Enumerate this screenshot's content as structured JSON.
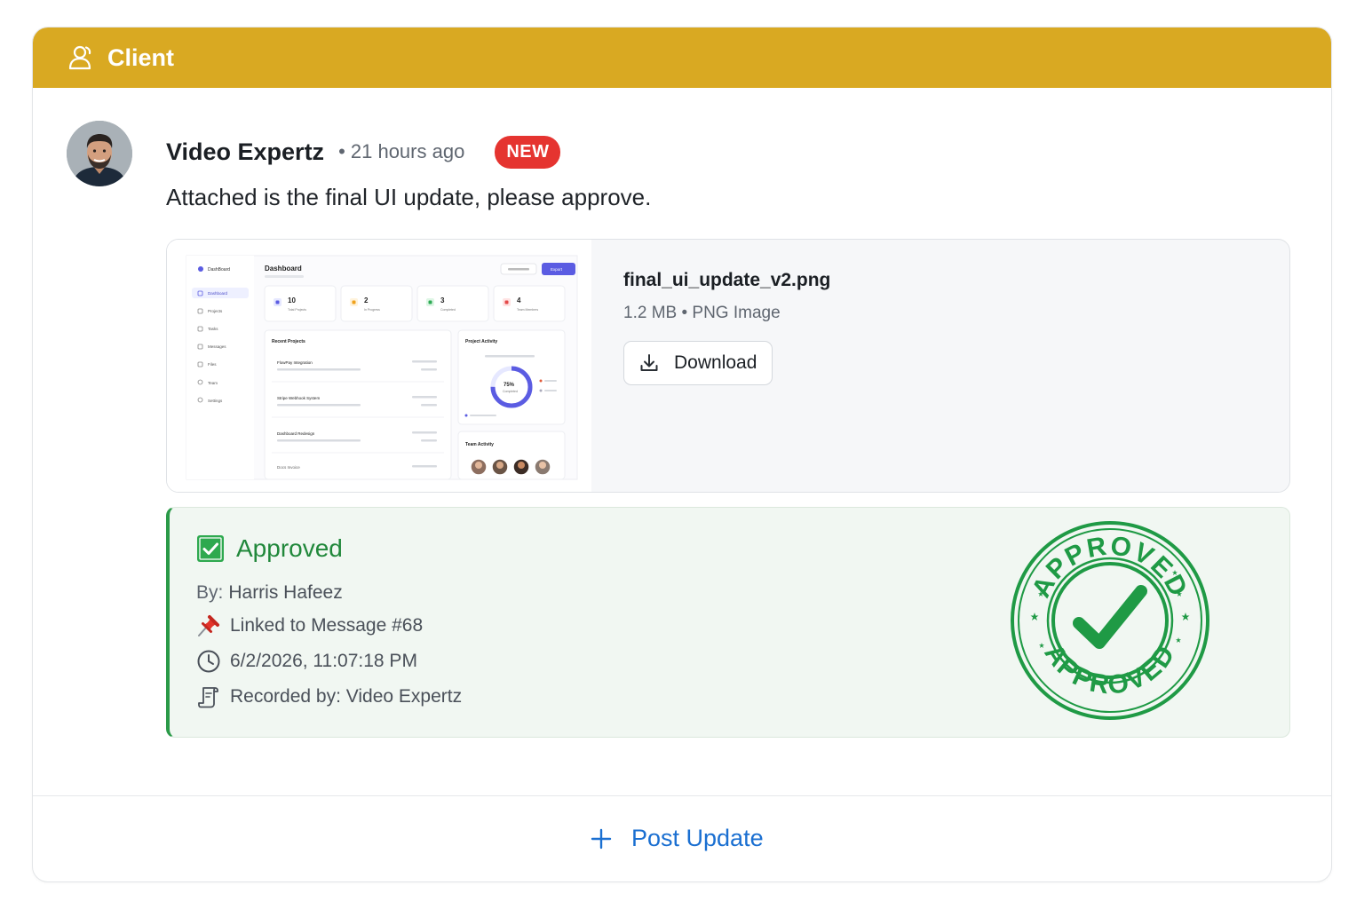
{
  "header": {
    "title": "Client",
    "icon": "user-icon",
    "color": "#d9a922"
  },
  "post": {
    "author": "Video Expertz",
    "time": "• 21 hours ago",
    "badge": "NEW",
    "message": "Attached is the final UI update, please approve.",
    "avatar_icon": "avatar-photo"
  },
  "attachment": {
    "file_name": "final_ui_update_v2.png",
    "file_meta": "1.2 MB • PNG Image",
    "download_label": "Download",
    "preview": {
      "brand": "DashBoard",
      "title": "Dashboard",
      "top_button": "Export",
      "nav": [
        "Dashboard",
        "Projects",
        "Tasks",
        "Messages",
        "Files",
        "Team",
        "Settings"
      ],
      "stats": [
        {
          "value": "10",
          "label": "Total Projects"
        },
        {
          "value": "2",
          "label": "In Progress"
        },
        {
          "value": "3",
          "label": "Completed"
        },
        {
          "value": "4",
          "label": "Team Members"
        }
      ],
      "recent_title": "Recent Projects",
      "projects": [
        "FlowPay Integration",
        "Stripe Webhook System",
        "Dashboard Redesign",
        "Docs Invoice"
      ],
      "activity_title": "Project Activity",
      "activity_percent": "75%",
      "activity_caption": "Completed",
      "team_title": "Team Activity"
    }
  },
  "approval": {
    "title": "Approved",
    "by_label": "By:",
    "by_value": "Harris Hafeez",
    "linked": "Linked to Message #68",
    "datetime": "6/2/2026, 11:07:18 PM",
    "recorded": "Recorded by: Video Expertz",
    "stamp_text": "APPROVED",
    "accent": "#2a9a48"
  },
  "footer": {
    "post_update_label": "Post Update",
    "link_color": "#1a6fd1"
  }
}
